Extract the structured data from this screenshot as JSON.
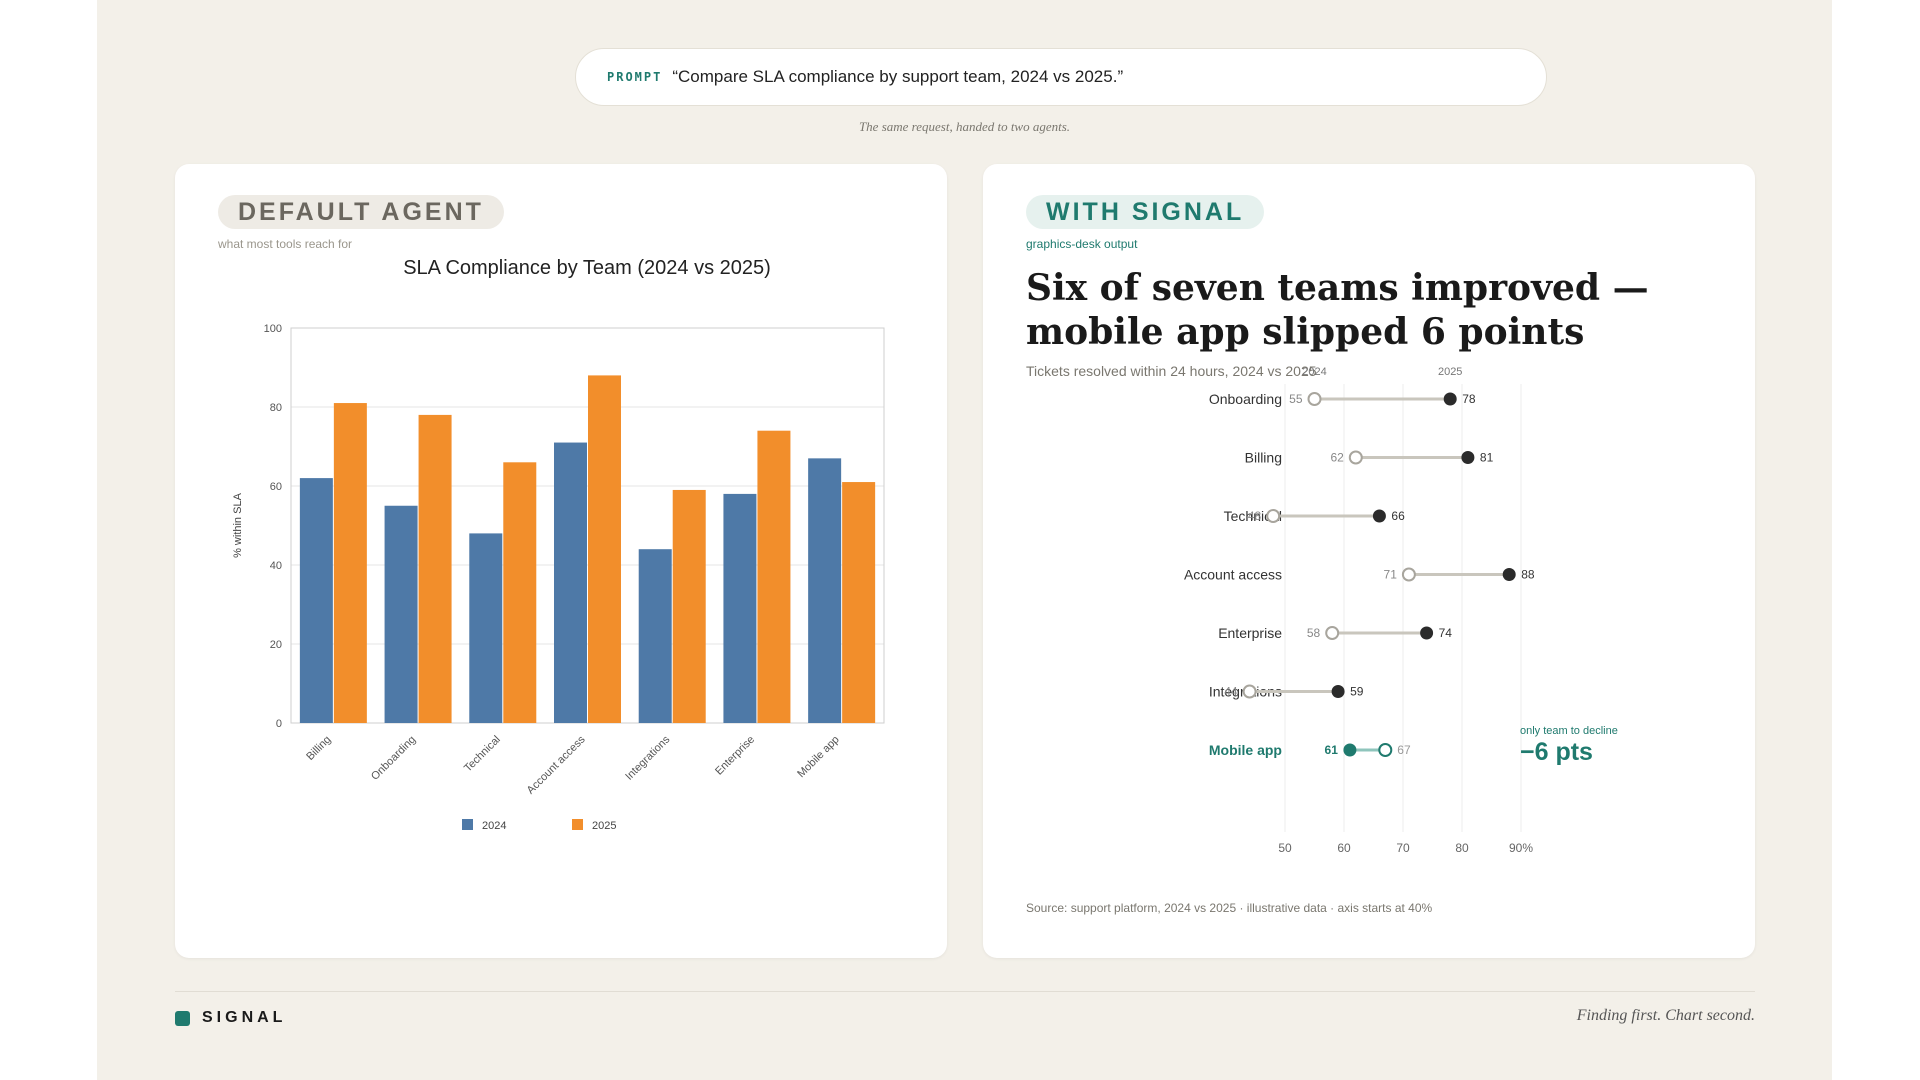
{
  "prompt": {
    "tag": "PROMPT",
    "text": "“Compare SLA compliance by support team, 2024 vs 2025.”"
  },
  "caption": "The same request, handed to two agents.",
  "left_card": {
    "badge": "DEFAULT AGENT",
    "subtitle": "what most tools reach for"
  },
  "right_card": {
    "badge": "WITH SIGNAL",
    "subtitle": "graphics-desk output",
    "headline": "Six of seven teams improved — mobile app slipped 6 points",
    "chart_subtitle": "Tickets resolved within 24 hours, 2024 vs 2025",
    "source": "Source: support platform, 2024 vs 2025 · illustrative data · axis starts at 40%"
  },
  "footer": {
    "brand": "SIGNAL",
    "tagline": "Finding first. Chart second."
  },
  "colors": {
    "bar_2024": "#4e79a7",
    "bar_2025": "#f28e2b",
    "dot_2025": "#2b2b2b",
    "dot_2024_outline": "#a8a59d",
    "connector": "#c9c6bd",
    "accent": "#1f7a6e"
  },
  "chart_data": [
    {
      "type": "bar",
      "title": "SLA Compliance by Team (2024 vs 2025)",
      "xlabel": "",
      "ylabel": "% within SLA",
      "categories": [
        "Billing",
        "Onboarding",
        "Technical",
        "Account access",
        "Integrations",
        "Enterprise",
        "Mobile app"
      ],
      "series": [
        {
          "name": "2024",
          "values": [
            62,
            55,
            48,
            71,
            44,
            58,
            67
          ]
        },
        {
          "name": "2025",
          "values": [
            81,
            78,
            66,
            88,
            59,
            74,
            61
          ]
        }
      ],
      "ylim": [
        0,
        100
      ],
      "yticks": [
        0,
        20,
        40,
        60,
        80,
        100
      ],
      "grid": true,
      "legend": "bottom"
    },
    {
      "type": "dumbbell",
      "categories": [
        "Onboarding",
        "Billing",
        "Technical",
        "Account access",
        "Enterprise",
        "Integrations",
        "Mobile app"
      ],
      "series": [
        {
          "name": "2024",
          "values": [
            55,
            62,
            48,
            71,
            58,
            44,
            67
          ]
        },
        {
          "name": "2025",
          "values": [
            78,
            81,
            66,
            88,
            74,
            59,
            61
          ]
        }
      ],
      "xlim": [
        50,
        90
      ],
      "xticks": [
        {
          "value": 50,
          "label": "50"
        },
        {
          "value": 60,
          "label": "60"
        },
        {
          "value": 70,
          "label": "70"
        },
        {
          "value": 80,
          "label": "80"
        },
        {
          "value": 90,
          "label": "90%"
        }
      ],
      "highlight": {
        "category": "Mobile app",
        "note": "only team to decline",
        "delta": "−6 pts"
      },
      "grid": true
    }
  ]
}
